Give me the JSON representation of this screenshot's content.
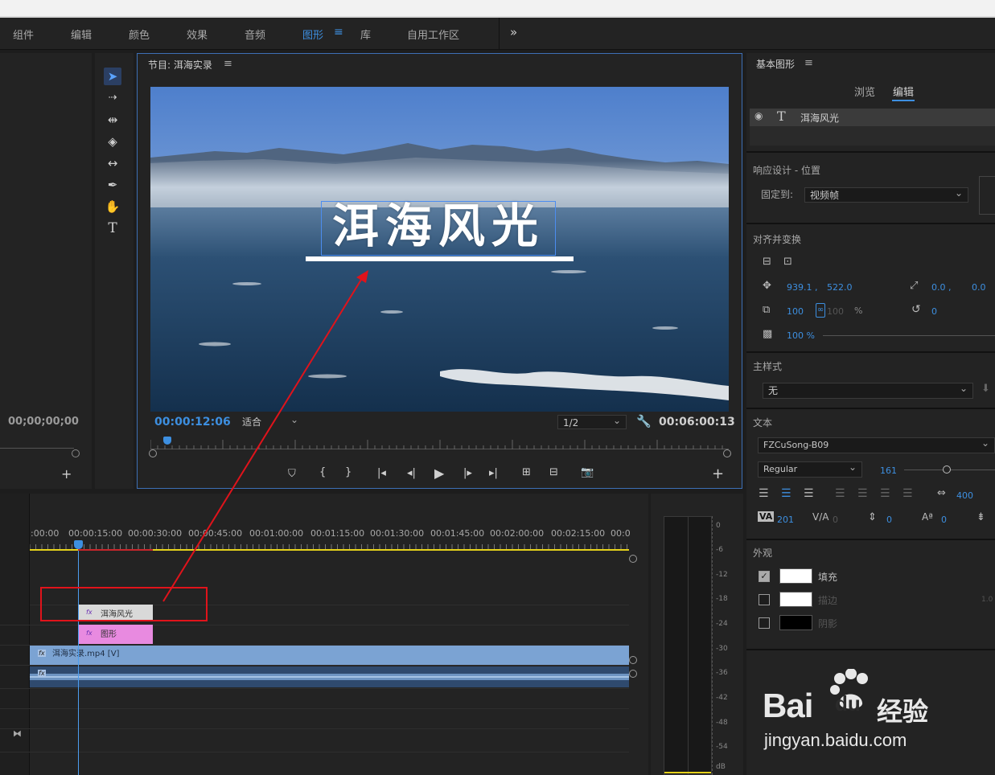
{
  "menu": {
    "items": [
      "组件",
      "编辑",
      "颜色",
      "效果",
      "音频",
      "图形",
      "库",
      "自用工作区"
    ],
    "active": "图形",
    "overflow": "»"
  },
  "left_panel": {
    "timecode": "00;00;00;00",
    "add": "+"
  },
  "program_monitor": {
    "title": "节目: 洱海实录",
    "overlay_text": "洱海风光",
    "current_time": "00:00:12:06",
    "fit": "适合",
    "resolution": "1/2",
    "duration": "00:06:00:13",
    "add": "+"
  },
  "timeline": {
    "ruler_labels": [
      ":00:00",
      "00:00:15:00",
      "00:00:30:00",
      "00:00:45:00",
      "00:01:00:00",
      "00:01:15:00",
      "00:01:30:00",
      "00:01:45:00",
      "00:02:00:00",
      "00:02:15:00",
      "00:0"
    ],
    "clips": {
      "title_clip": "洱海风光",
      "graphic_clip": "图形",
      "video_clip": "洱海实录.mp4 [V]",
      "fx": "fx"
    }
  },
  "audio_meter": {
    "labels": [
      "0",
      "-6",
      "-12",
      "-18",
      "-24",
      "-30",
      "-36",
      "-42",
      "-48",
      "-54",
      "dB"
    ]
  },
  "essential_graphics": {
    "title": "基本图形",
    "tabs": [
      "浏览",
      "编辑"
    ],
    "active_tab": "编辑",
    "layer_name": "洱海风光",
    "responsive_section": "响应设计 - 位置",
    "pin_label": "固定到:",
    "pin_value": "视频帧",
    "align_section": "对齐并变换",
    "position_x": "939.1 ,",
    "position_y": "522.0",
    "anchor_x": "0.0 ,",
    "anchor_y": "0.0",
    "scale": "100",
    "scale_h": "100",
    "scale_pct": "%",
    "rotation": "0",
    "opacity": "100 %",
    "master_style_section": "主样式",
    "master_style_value": "无",
    "text_section": "文本",
    "font": "FZCuSong-B09",
    "font_style": "Regular",
    "font_size": "161",
    "tracking_value": "400",
    "kerning": "201",
    "va_value": "0",
    "leading": "0",
    "baseline": "0",
    "appearance_section": "外观",
    "fill_label": "填充",
    "stroke_label": "描边",
    "shadow_label": "阴影",
    "stroke_width": "1.0",
    "fill_color": "#ffffff",
    "stroke_color": "#ffffff",
    "shadow_color": "#000000"
  },
  "watermark": {
    "brand": "Bai",
    "brand_suffix": "du",
    "brand_cn": "经验",
    "url": "jingyan.baidu.com"
  },
  "colors": {
    "accent": "#3d8fe0",
    "annotation": "#e0131b",
    "graphic_clip": "#e88ae0",
    "video_clip": "#7ba3d3"
  }
}
